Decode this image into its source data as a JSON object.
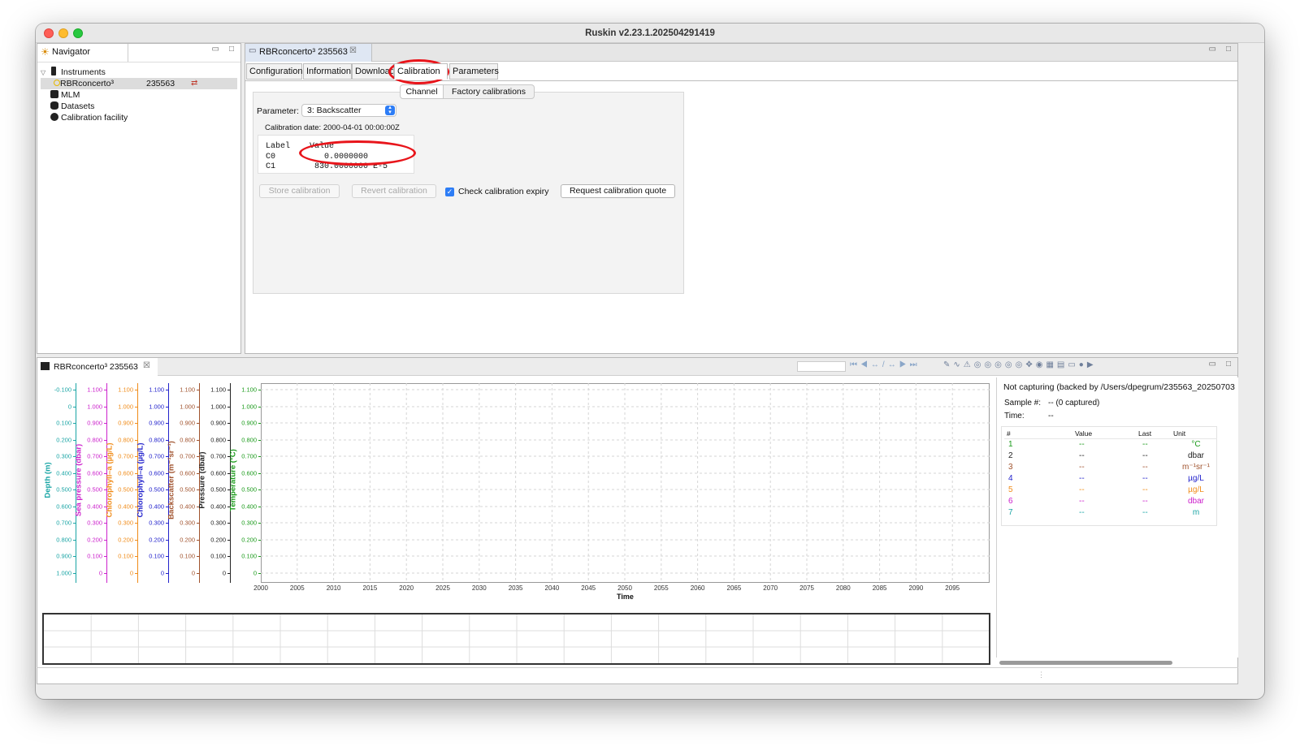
{
  "window": {
    "title": "Ruskin v2.23.1.202504291419"
  },
  "navigator": {
    "tab_label": "Navigator",
    "items": [
      {
        "label": "Instruments",
        "icon": "instruments-icon"
      },
      {
        "label": "RBRconcerto³",
        "serial": "235563",
        "icon": "instrument-status-icon"
      },
      {
        "label": "MLM",
        "icon": "mlm-icon"
      },
      {
        "label": "Datasets",
        "icon": "datasets-icon"
      },
      {
        "label": "Calibration facility",
        "icon": "calibration-facility-icon"
      }
    ]
  },
  "editor": {
    "tab_label": "RBRconcerto³ 235563",
    "tabs": [
      "Configuration",
      "Information",
      "Download",
      "Calibration",
      "Parameters"
    ],
    "active_tab": "Calibration",
    "subtabs": [
      "Channel",
      "Factory calibrations"
    ],
    "active_subtab": "Channel",
    "parameter_label": "Parameter:",
    "parameter_value": "3: Backscatter",
    "calibration_date": "Calibration date: 2000-04-01 00:00:00Z",
    "coeff_headers": [
      "Label",
      "Value"
    ],
    "coefficients": [
      {
        "label": "C0",
        "value": "0.0000000"
      },
      {
        "label": "C1",
        "value": "830.0000000 E-5"
      }
    ],
    "store_button": "Store calibration",
    "revert_button": "Revert calibration",
    "check_expiry_label": "Check calibration expiry",
    "check_expiry_checked": true,
    "quote_button": "Request calibration quote"
  },
  "plot_view": {
    "tab_label": "RBRconcerto³ 235563",
    "x_label": "Time",
    "x_ticks": [
      "2000",
      "2005",
      "2010",
      "2015",
      "2020",
      "2025",
      "2030",
      "2035",
      "2040",
      "2045",
      "2050",
      "2055",
      "2060",
      "2065",
      "2070",
      "2075",
      "2080",
      "2085",
      "2090",
      "2095"
    ],
    "axes": [
      {
        "title": "Depth (m)",
        "color": "#1aa5a5",
        "ticks": [
          "-0.100",
          "0",
          "0.100",
          "0.200",
          "0.300",
          "0.400",
          "0.500",
          "0.600",
          "0.700",
          "0.800",
          "0.900",
          "1.000"
        ]
      },
      {
        "title": "Sea pressure (dbar)",
        "color": "#cc22cc",
        "ticks": [
          "1.100",
          "1.000",
          "0.900",
          "0.800",
          "0.700",
          "0.600",
          "0.500",
          "0.400",
          "0.300",
          "0.200",
          "0.100",
          "0"
        ]
      },
      {
        "title": "Chlorophyll–a (µg/L)",
        "color": "#f08c1a",
        "ticks": [
          "1.100",
          "1.000",
          "0.900",
          "0.800",
          "0.700",
          "0.600",
          "0.500",
          "0.400",
          "0.300",
          "0.200",
          "0.100",
          "0"
        ]
      },
      {
        "title": "Chlorophyll–a (µg/L)",
        "color": "#2222cc",
        "ticks": [
          "1.100",
          "1.000",
          "0.900",
          "0.800",
          "0.700",
          "0.600",
          "0.500",
          "0.400",
          "0.300",
          "0.200",
          "0.100",
          "0"
        ]
      },
      {
        "title": "Backscatter (m⁻¹sr⁻¹)",
        "color": "#a0522d",
        "ticks": [
          "1.100",
          "1.000",
          "0.900",
          "0.800",
          "0.700",
          "0.600",
          "0.500",
          "0.400",
          "0.300",
          "0.200",
          "0.100",
          "0"
        ]
      },
      {
        "title": "Pressure (dbar)",
        "color": "#222222",
        "ticks": [
          "1.100",
          "1.000",
          "0.900",
          "0.800",
          "0.700",
          "0.600",
          "0.500",
          "0.400",
          "0.300",
          "0.200",
          "0.100",
          "0"
        ]
      },
      {
        "title": "Temperature (°C)",
        "color": "#1a9a1a",
        "ticks": [
          "1.100",
          "1.000",
          "0.900",
          "0.800",
          "0.700",
          "0.600",
          "0.500",
          "0.400",
          "0.300",
          "0.200",
          "0.100",
          "0"
        ]
      }
    ]
  },
  "live": {
    "status": "Not capturing (backed by /Users/dpegrum/235563_20250703",
    "sample_label": "Sample #:",
    "sample_value": "-- (0 captured)",
    "time_label": "Time:",
    "time_value": "--",
    "headers": [
      "#",
      "Value",
      "Last",
      "Unit"
    ],
    "rows": [
      {
        "n": "1",
        "value": "--",
        "last": "--",
        "unit": "°C",
        "color": "#1a9a1a"
      },
      {
        "n": "2",
        "value": "--",
        "last": "--",
        "unit": "dbar",
        "color": "#222222"
      },
      {
        "n": "3",
        "value": "--",
        "last": "--",
        "unit": "m⁻¹sr⁻¹",
        "color": "#a0522d"
      },
      {
        "n": "4",
        "value": "--",
        "last": "--",
        "unit": "µg/L",
        "color": "#2222cc"
      },
      {
        "n": "5",
        "value": "--",
        "last": "--",
        "unit": "µg/L",
        "color": "#f08c1a"
      },
      {
        "n": "6",
        "value": "--",
        "last": "--",
        "unit": "dbar",
        "color": "#cc22cc"
      },
      {
        "n": "7",
        "value": "--",
        "last": "--",
        "unit": "m",
        "color": "#1aa5a5"
      }
    ]
  }
}
